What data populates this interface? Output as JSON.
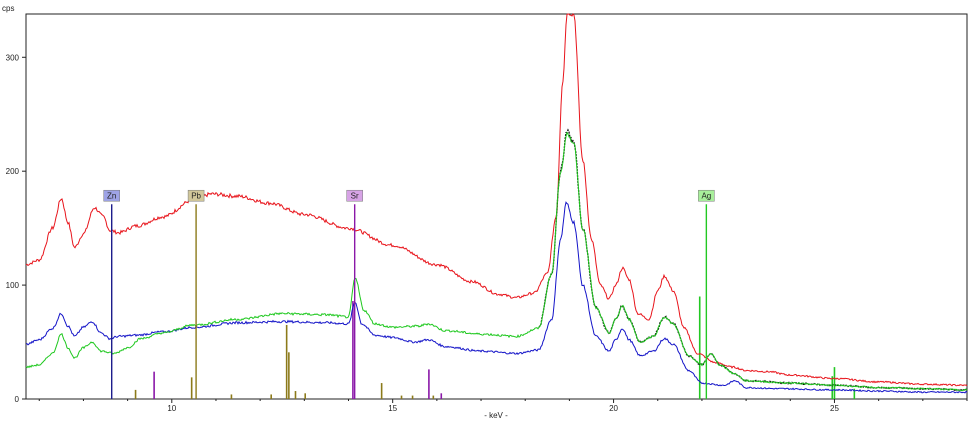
{
  "chart_data": {
    "type": "line",
    "title": "",
    "xlabel": "- keV -",
    "ylabel": "cps",
    "xlim": [
      6.7,
      28.0
    ],
    "ylim": [
      0,
      338
    ],
    "x_ticks": [
      10,
      15,
      20,
      25
    ],
    "x_tick_labels": [
      "10",
      "15",
      "20",
      "25"
    ],
    "y_ticks": [
      0,
      100,
      200,
      300
    ],
    "y_tick_labels": [
      "0",
      "100",
      "200",
      "300"
    ],
    "grid": false,
    "legend": "none",
    "series": [
      {
        "color": "#e8141b",
        "points": [
          [
            6.7,
            118
          ],
          [
            7.0,
            122
          ],
          [
            7.3,
            150
          ],
          [
            7.5,
            176
          ],
          [
            7.65,
            155
          ],
          [
            7.8,
            133
          ],
          [
            8.0,
            145
          ],
          [
            8.25,
            168
          ],
          [
            8.45,
            160
          ],
          [
            8.6,
            148
          ],
          [
            8.8,
            146
          ],
          [
            9.2,
            152
          ],
          [
            9.8,
            160
          ],
          [
            10.5,
            175
          ],
          [
            10.9,
            180
          ],
          [
            11.5,
            178
          ],
          [
            12.2,
            172
          ],
          [
            13.0,
            162
          ],
          [
            14.0,
            150
          ],
          [
            15.0,
            135
          ],
          [
            16.0,
            118
          ],
          [
            16.8,
            103
          ],
          [
            17.4,
            92
          ],
          [
            17.8,
            89
          ],
          [
            18.2,
            93
          ],
          [
            18.5,
            110
          ],
          [
            18.7,
            160
          ],
          [
            18.85,
            280
          ],
          [
            18.95,
            340
          ],
          [
            19.1,
            338
          ],
          [
            19.3,
            210
          ],
          [
            19.5,
            140
          ],
          [
            19.7,
            100
          ],
          [
            19.9,
            88
          ],
          [
            20.05,
            100
          ],
          [
            20.2,
            115
          ],
          [
            20.35,
            105
          ],
          [
            20.55,
            75
          ],
          [
            20.8,
            70
          ],
          [
            21.0,
            95
          ],
          [
            21.15,
            108
          ],
          [
            21.35,
            95
          ],
          [
            21.6,
            62
          ],
          [
            21.9,
            40
          ],
          [
            22.3,
            32
          ],
          [
            22.7,
            28
          ],
          [
            23.0,
            25
          ],
          [
            23.5,
            24
          ],
          [
            24.0,
            21
          ],
          [
            25.0,
            18
          ],
          [
            26.0,
            15
          ],
          [
            27.0,
            13
          ],
          [
            28.0,
            12
          ]
        ]
      },
      {
        "color": "#1414c8",
        "points": [
          [
            6.7,
            48
          ],
          [
            7.0,
            52
          ],
          [
            7.3,
            62
          ],
          [
            7.5,
            75
          ],
          [
            7.65,
            64
          ],
          [
            7.8,
            55
          ],
          [
            8.0,
            63
          ],
          [
            8.2,
            68
          ],
          [
            8.4,
            58
          ],
          [
            8.6,
            53
          ],
          [
            8.8,
            55
          ],
          [
            9.2,
            56
          ],
          [
            9.8,
            59
          ],
          [
            10.5,
            63
          ],
          [
            11.5,
            67
          ],
          [
            12.5,
            68
          ],
          [
            13.5,
            67
          ],
          [
            14.0,
            66
          ],
          [
            14.15,
            85
          ],
          [
            14.3,
            66
          ],
          [
            14.6,
            56
          ],
          [
            15.0,
            54
          ],
          [
            15.5,
            50
          ],
          [
            15.8,
            52
          ],
          [
            16.2,
            46
          ],
          [
            17.0,
            42
          ],
          [
            17.8,
            40
          ],
          [
            18.3,
            43
          ],
          [
            18.6,
            70
          ],
          [
            18.8,
            140
          ],
          [
            18.93,
            172
          ],
          [
            19.1,
            155
          ],
          [
            19.3,
            100
          ],
          [
            19.6,
            55
          ],
          [
            19.9,
            42
          ],
          [
            20.05,
            52
          ],
          [
            20.2,
            62
          ],
          [
            20.35,
            52
          ],
          [
            20.6,
            38
          ],
          [
            20.9,
            42
          ],
          [
            21.15,
            53
          ],
          [
            21.35,
            48
          ],
          [
            21.7,
            25
          ],
          [
            22.0,
            14
          ],
          [
            22.5,
            12
          ],
          [
            22.75,
            16
          ],
          [
            23.0,
            10
          ],
          [
            23.8,
            9
          ],
          [
            25.0,
            8
          ],
          [
            26.0,
            7
          ],
          [
            27.0,
            6
          ],
          [
            28.0,
            6
          ]
        ]
      },
      {
        "color": "#111111",
        "points": [
          [
            18.3,
            62
          ],
          [
            18.6,
            110
          ],
          [
            18.8,
            200
          ],
          [
            18.95,
            235
          ],
          [
            19.1,
            225
          ],
          [
            19.3,
            150
          ],
          [
            19.6,
            80
          ],
          [
            19.9,
            58
          ],
          [
            20.05,
            70
          ],
          [
            20.2,
            82
          ],
          [
            20.35,
            70
          ],
          [
            20.6,
            50
          ],
          [
            20.9,
            55
          ],
          [
            21.15,
            72
          ],
          [
            21.35,
            66
          ],
          [
            21.7,
            38
          ],
          [
            22.0,
            30
          ],
          [
            22.2,
            40
          ],
          [
            22.4,
            30
          ],
          [
            22.75,
            22
          ],
          [
            23.0,
            16
          ],
          [
            24.0,
            14
          ],
          [
            25.0,
            12
          ],
          [
            26.0,
            10
          ],
          [
            27.0,
            9
          ],
          [
            28.0,
            8
          ]
        ]
      },
      {
        "color": "#1ec81e",
        "points": [
          [
            6.7,
            28
          ],
          [
            7.0,
            30
          ],
          [
            7.3,
            40
          ],
          [
            7.5,
            57
          ],
          [
            7.65,
            45
          ],
          [
            7.8,
            36
          ],
          [
            8.0,
            45
          ],
          [
            8.2,
            50
          ],
          [
            8.4,
            42
          ],
          [
            8.7,
            40
          ],
          [
            9.0,
            45
          ],
          [
            9.3,
            53
          ],
          [
            9.8,
            58
          ],
          [
            10.5,
            65
          ],
          [
            11.5,
            70
          ],
          [
            12.5,
            75
          ],
          [
            13.5,
            74
          ],
          [
            14.0,
            72
          ],
          [
            14.15,
            106
          ],
          [
            14.35,
            78
          ],
          [
            14.6,
            66
          ],
          [
            15.0,
            63
          ],
          [
            15.6,
            64
          ],
          [
            15.8,
            66
          ],
          [
            16.2,
            60
          ],
          [
            17.0,
            57
          ],
          [
            17.8,
            55
          ],
          [
            18.3,
            62
          ],
          [
            18.6,
            110
          ],
          [
            18.8,
            200
          ],
          [
            18.95,
            232
          ],
          [
            19.1,
            225
          ],
          [
            19.3,
            150
          ],
          [
            19.6,
            80
          ],
          [
            19.9,
            58
          ],
          [
            20.05,
            70
          ],
          [
            20.2,
            82
          ],
          [
            20.35,
            70
          ],
          [
            20.6,
            50
          ],
          [
            20.9,
            55
          ],
          [
            21.15,
            72
          ],
          [
            21.35,
            66
          ],
          [
            21.7,
            38
          ],
          [
            22.0,
            30
          ],
          [
            22.2,
            40
          ],
          [
            22.4,
            30
          ],
          [
            22.75,
            22
          ],
          [
            23.0,
            16
          ],
          [
            24.0,
            14
          ],
          [
            25.0,
            12
          ],
          [
            26.0,
            10
          ],
          [
            27.0,
            9
          ],
          [
            28.0,
            8
          ]
        ]
      }
    ],
    "markers": [
      {
        "label": "Zn",
        "x": 8.64,
        "height": 171,
        "color": "#1c1c8c",
        "label_bg": "#9ea3e6"
      },
      {
        "label": "Pb",
        "x": 10.55,
        "height": 171,
        "color": "#8c7a1a",
        "label_bg": "#d1c79a"
      },
      {
        "label": "Sr",
        "x": 14.14,
        "height": 171,
        "color": "#8a18a8",
        "label_bg": "#d7a3e6"
      },
      {
        "label": "Ag",
        "x": 22.1,
        "height": 171,
        "color": "#23c823",
        "label_bg": "#a8ef9b"
      }
    ],
    "lines": [
      {
        "x": 9.18,
        "height": 8,
        "color": "#8c7a1a"
      },
      {
        "x": 9.6,
        "height": 24,
        "color": "#8a18a8"
      },
      {
        "x": 10.45,
        "height": 19,
        "color": "#8c7a1a"
      },
      {
        "x": 11.35,
        "height": 4,
        "color": "#8c7a1a"
      },
      {
        "x": 12.25,
        "height": 4,
        "color": "#8c7a1a"
      },
      {
        "x": 12.6,
        "height": 65,
        "color": "#8c7a1a"
      },
      {
        "x": 12.65,
        "height": 41,
        "color": "#8c7a1a"
      },
      {
        "x": 12.8,
        "height": 7,
        "color": "#8c7a1a"
      },
      {
        "x": 13.02,
        "height": 5,
        "color": "#8c7a1a"
      },
      {
        "x": 14.1,
        "height": 86,
        "color": "#8a18a8"
      },
      {
        "x": 14.75,
        "height": 14,
        "color": "#8c7a1a"
      },
      {
        "x": 15.2,
        "height": 3,
        "color": "#8c7a1a"
      },
      {
        "x": 15.45,
        "height": 3,
        "color": "#8c7a1a"
      },
      {
        "x": 15.82,
        "height": 26,
        "color": "#8a18a8"
      },
      {
        "x": 15.92,
        "height": 3,
        "color": "#8c7a1a"
      },
      {
        "x": 16.1,
        "height": 5,
        "color": "#8a18a8"
      },
      {
        "x": 21.95,
        "height": 90,
        "color": "#23c823"
      },
      {
        "x": 24.95,
        "height": 20,
        "color": "#23c823"
      },
      {
        "x": 25.0,
        "height": 28,
        "color": "#23c823"
      },
      {
        "x": 25.45,
        "height": 9,
        "color": "#23c823"
      }
    ]
  }
}
